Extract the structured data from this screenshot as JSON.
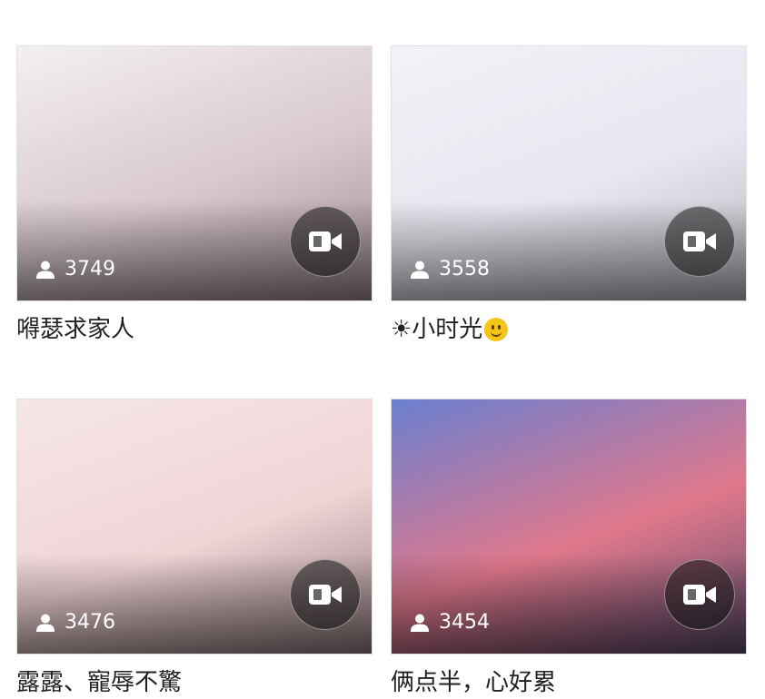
{
  "streams": [
    {
      "viewers": "3749",
      "title": "嘚瑟求家人",
      "emoji": "",
      "colors": [
        "#f3f0f2",
        "#d8c8cc",
        "#9a8890"
      ]
    },
    {
      "viewers": "3558",
      "title": "☀小时光",
      "emoji": "smile-emoji",
      "colors": [
        "#f4f2f8",
        "#e8e6ee",
        "#b8b4bc"
      ]
    },
    {
      "viewers": "3476",
      "title": "露露、寵辱不驚",
      "emoji": "",
      "colors": [
        "#f6e6e8",
        "#f0d4d6",
        "#8e7a7c"
      ]
    },
    {
      "viewers": "3454",
      "title": "俩点半，心好累",
      "emoji": "",
      "colors": [
        "#6a7fd0",
        "#e0788c",
        "#5a4a6a"
      ]
    }
  ],
  "icons": {
    "viewer": "person-icon",
    "video": "video-camera-icon"
  }
}
